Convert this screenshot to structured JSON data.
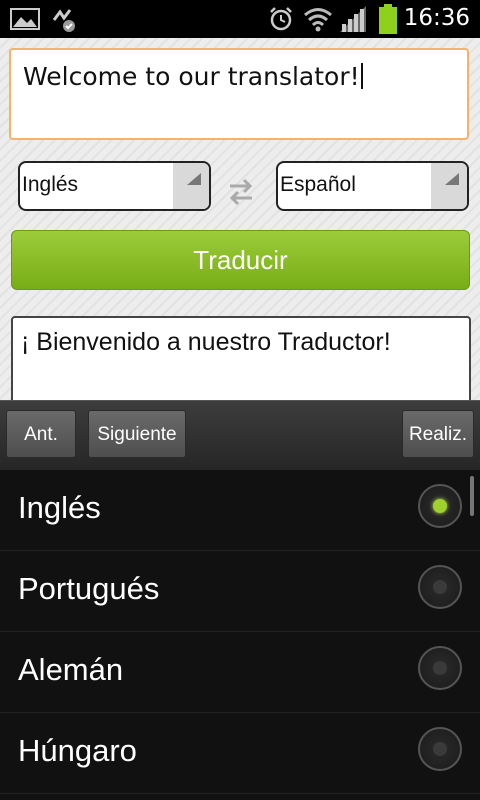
{
  "status_bar": {
    "time": "16:36",
    "left_icons": [
      "gallery-icon",
      "sync-icon"
    ],
    "right_icons": [
      "alarm-icon",
      "wifi-icon",
      "signal-icon",
      "battery-icon"
    ]
  },
  "translator": {
    "source_text": "Welcome to our translator!",
    "source_language": "Inglés",
    "target_language": "Español",
    "swap_icon": "swap-arrows-icon",
    "translate_label": "Traducir",
    "result_text": "¡ Bienvenido a nuestro Traductor!"
  },
  "keyboard_toolbar": {
    "prev_label": "Ant.",
    "next_label": "Siguiente",
    "done_label": "Realiz."
  },
  "language_picker": {
    "items": [
      {
        "label": "Inglés",
        "selected": true
      },
      {
        "label": "Portugués",
        "selected": false
      },
      {
        "label": "Alemán",
        "selected": false
      },
      {
        "label": "Húngaro",
        "selected": false
      }
    ]
  },
  "colors": {
    "accent_green": "#8bbf28",
    "focus_orange": "#f4b36a",
    "radio_selected": "#9fd02b"
  }
}
